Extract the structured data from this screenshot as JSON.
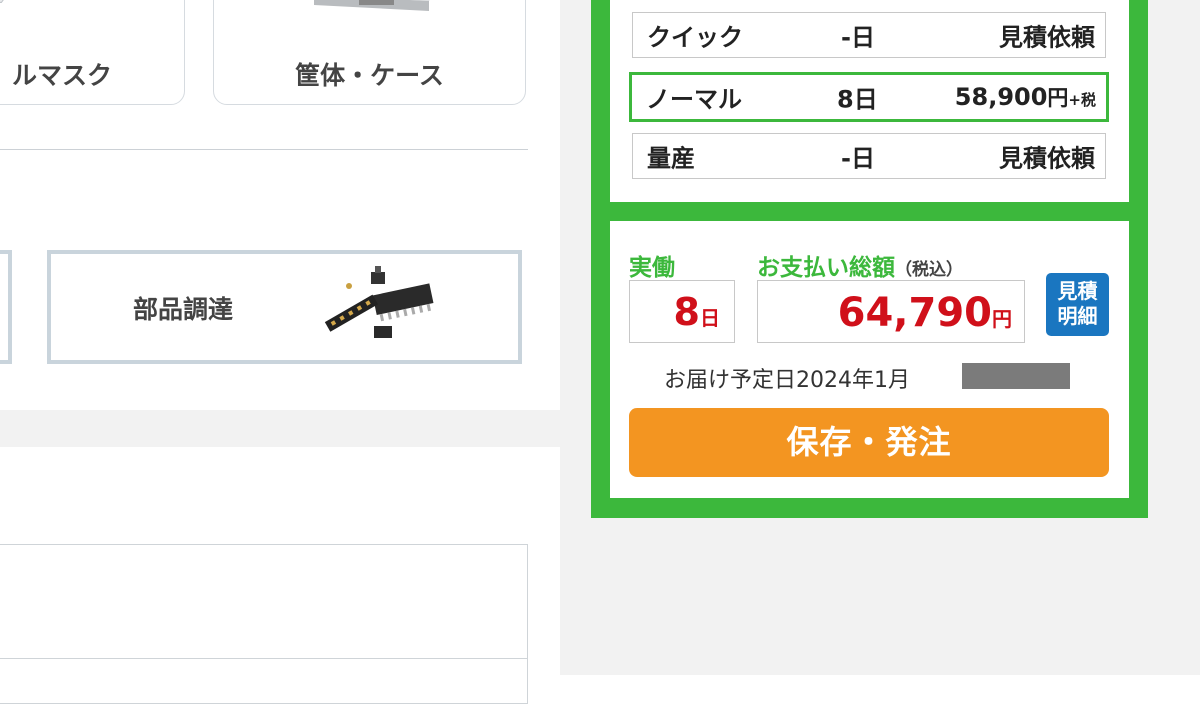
{
  "categories": [
    {
      "label": "ルマスク",
      "icon": "metal-mask-thumbnail"
    },
    {
      "label": "筐体・ケース",
      "icon": "enclosure-thumbnail"
    }
  ],
  "services": [
    {
      "label": "部品調達",
      "icon": "electronic-parts-image"
    }
  ],
  "plans": [
    {
      "name": "クイック",
      "days": "-日",
      "price": "見積依頼"
    },
    {
      "name": "ノーマル",
      "days": "8日",
      "price_value": "58,900",
      "price_unit": "円",
      "price_tax": "+税",
      "selected": true
    },
    {
      "name": "量産",
      "days": "-日",
      "price": "見積依頼"
    }
  ],
  "summary": {
    "work_days_label": "実働",
    "total_label": "お支払い総額",
    "total_label_note": "（税込）",
    "work_days_value": "8",
    "work_days_unit": "日",
    "total_value": "64,790",
    "total_unit": "円",
    "quote_button_line1": "見積",
    "quote_button_line2": "明細",
    "delivery_text": "お届け予定日2024年1月"
  },
  "order_button_label": "保存・発注",
  "colors": {
    "accent_green": "#3cb83c",
    "price_red": "#d0101a",
    "button_orange": "#f39521",
    "button_blue": "#1a76c0"
  }
}
